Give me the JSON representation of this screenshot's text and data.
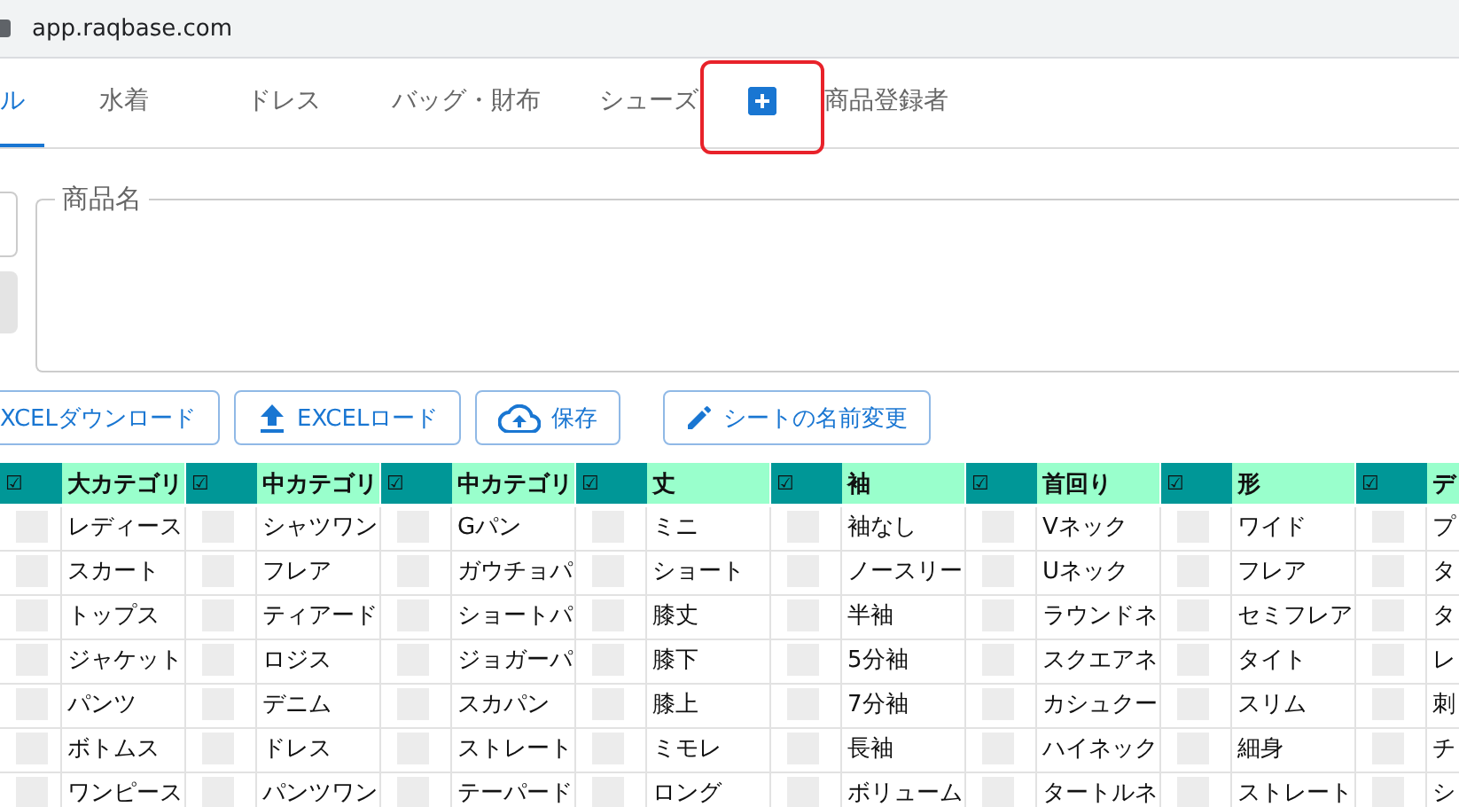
{
  "browser": {
    "url": "app.raqbase.com"
  },
  "tabs": [
    {
      "kind": "text",
      "label": "ル",
      "selected": true
    },
    {
      "kind": "text",
      "label": "水着",
      "selected": false
    },
    {
      "kind": "text",
      "label": "ドレス",
      "selected": false
    },
    {
      "kind": "text",
      "label": "バッグ・財布",
      "selected": false
    },
    {
      "kind": "text",
      "label": "シューズ",
      "selected": false
    },
    {
      "kind": "add",
      "selected": false,
      "highlighted": true
    },
    {
      "kind": "text",
      "label": "商品登録者",
      "selected": false
    }
  ],
  "product_name": {
    "legend": "商品名"
  },
  "buttons": [
    {
      "label": "XCELダウンロード",
      "kind": "plain"
    },
    {
      "label": "EXCELロード",
      "kind": "upload"
    },
    {
      "label": "保存",
      "kind": "save"
    },
    {
      "label": "シートの名前変更",
      "kind": "rename"
    }
  ],
  "table": {
    "columns": [
      {
        "check": "☑",
        "label": "大カテゴリ"
      },
      {
        "check": "☑",
        "label": "中カテゴリ"
      },
      {
        "check": "☑",
        "label": "中カテゴリ"
      },
      {
        "check": "☑",
        "label": "丈"
      },
      {
        "check": "☑",
        "label": "袖"
      },
      {
        "check": "☑",
        "label": "首回り"
      },
      {
        "check": "☑",
        "label": "形"
      },
      {
        "check": "☑",
        "label": "デ"
      }
    ],
    "rows": [
      {
        "checked": [
          false,
          false,
          false,
          false,
          false,
          false,
          false,
          false
        ],
        "cells": [
          "レディース",
          "シャツワン",
          "Gパン",
          "ミニ",
          "袖なし",
          "Vネック",
          "ワイド",
          "プ"
        ]
      },
      {
        "checked": [
          false,
          false,
          false,
          false,
          false,
          false,
          false,
          false
        ],
        "cells": [
          "スカート",
          "フレア",
          "ガウチョパ",
          "ショート",
          "ノースリー",
          "Uネック",
          "フレア",
          "タ"
        ]
      },
      {
        "checked": [
          false,
          false,
          false,
          false,
          false,
          false,
          false,
          false
        ],
        "cells": [
          "トップス",
          "ティアード",
          "ショートパ",
          "膝丈",
          "半袖",
          "ラウンドネ",
          "セミフレア",
          "タ"
        ]
      },
      {
        "checked": [
          false,
          false,
          false,
          false,
          false,
          false,
          false,
          false
        ],
        "cells": [
          "ジャケット",
          "ロジス",
          "ジョガーパ",
          "膝下",
          "5分袖",
          "スクエアネ",
          "タイト",
          "レ"
        ]
      },
      {
        "checked": [
          false,
          false,
          false,
          false,
          false,
          false,
          false,
          false
        ],
        "cells": [
          "パンツ",
          "デニム",
          "スカパン",
          "膝上",
          "7分袖",
          "カシュクー",
          "スリム",
          "刺"
        ]
      },
      {
        "checked": [
          false,
          false,
          false,
          false,
          false,
          false,
          false,
          false
        ],
        "cells": [
          "ボトムス",
          "ドレス",
          "ストレート",
          "ミモレ",
          "長袖",
          "ハイネック",
          "細身",
          "チ"
        ]
      },
      {
        "checked": [
          false,
          false,
          false,
          false,
          false,
          false,
          false,
          false
        ],
        "cells": [
          "ワンピース",
          "パンツワン",
          "テーパード",
          "ロング",
          "ボリューム",
          "タートルネ",
          "ストレート",
          "シ"
        ]
      }
    ]
  }
}
